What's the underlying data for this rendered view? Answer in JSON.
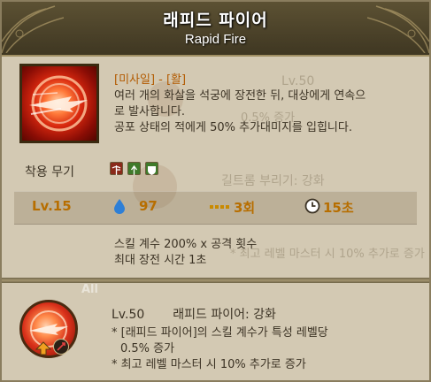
{
  "skill": {
    "name": "래피드 파이어",
    "name_en": "Rapid Fire",
    "category": "[미사일] - [활]",
    "description": [
      "여러 개의 화살을 석궁에 장전한 뒤, 대상에게 연속으",
      "로 발사합니다.",
      "공포 상태의 적에게 50% 추가대미지를 입힙니다."
    ],
    "icon": "rapid-fire-skill-icon"
  },
  "weapon": {
    "label": "착용 무기",
    "icons": [
      "crossbow-weapon-icon",
      "arrow-weapon-icon",
      "shield-weapon-icon"
    ]
  },
  "stats": {
    "level": "Lv.15",
    "mp_cost": "97",
    "uses": "3회",
    "cooldown": "15초",
    "mp_icon": "water-drop-icon",
    "uses_icon": "ammo-icon",
    "cooldown_icon": "clock-icon"
  },
  "info": [
    "스킬 계수 200% x 공격 횟수",
    "최대 장전 시간 1초"
  ],
  "enhancement": {
    "level": "Lv.50",
    "title": "래피드 파이어: 강화",
    "lines": [
      "* [래피드 파이어]의 스킬 계수가 특성 레벨당",
      "0.5% 증가",
      "* 최고 레벨 마스터 시 10% 추가로 증가"
    ],
    "icon": "rapid-fire-enhance-icon",
    "badge_icon": "upgrade-arrow-icon"
  },
  "background_ghost": {
    "tab_all": "All",
    "level": "Lv.50",
    "title": "길트롬 부리기: 강화",
    "lines": [
      "0.5% 증가",
      "* 최고 레벨 마스터 시 10% 추가로 증가"
    ]
  },
  "colors": {
    "header_bg": "#4a4029",
    "panel_bg": "#d3c9b3",
    "category_text": "#b25a00",
    "stat_text": "#b76e00",
    "body_text": "#3c3325"
  }
}
